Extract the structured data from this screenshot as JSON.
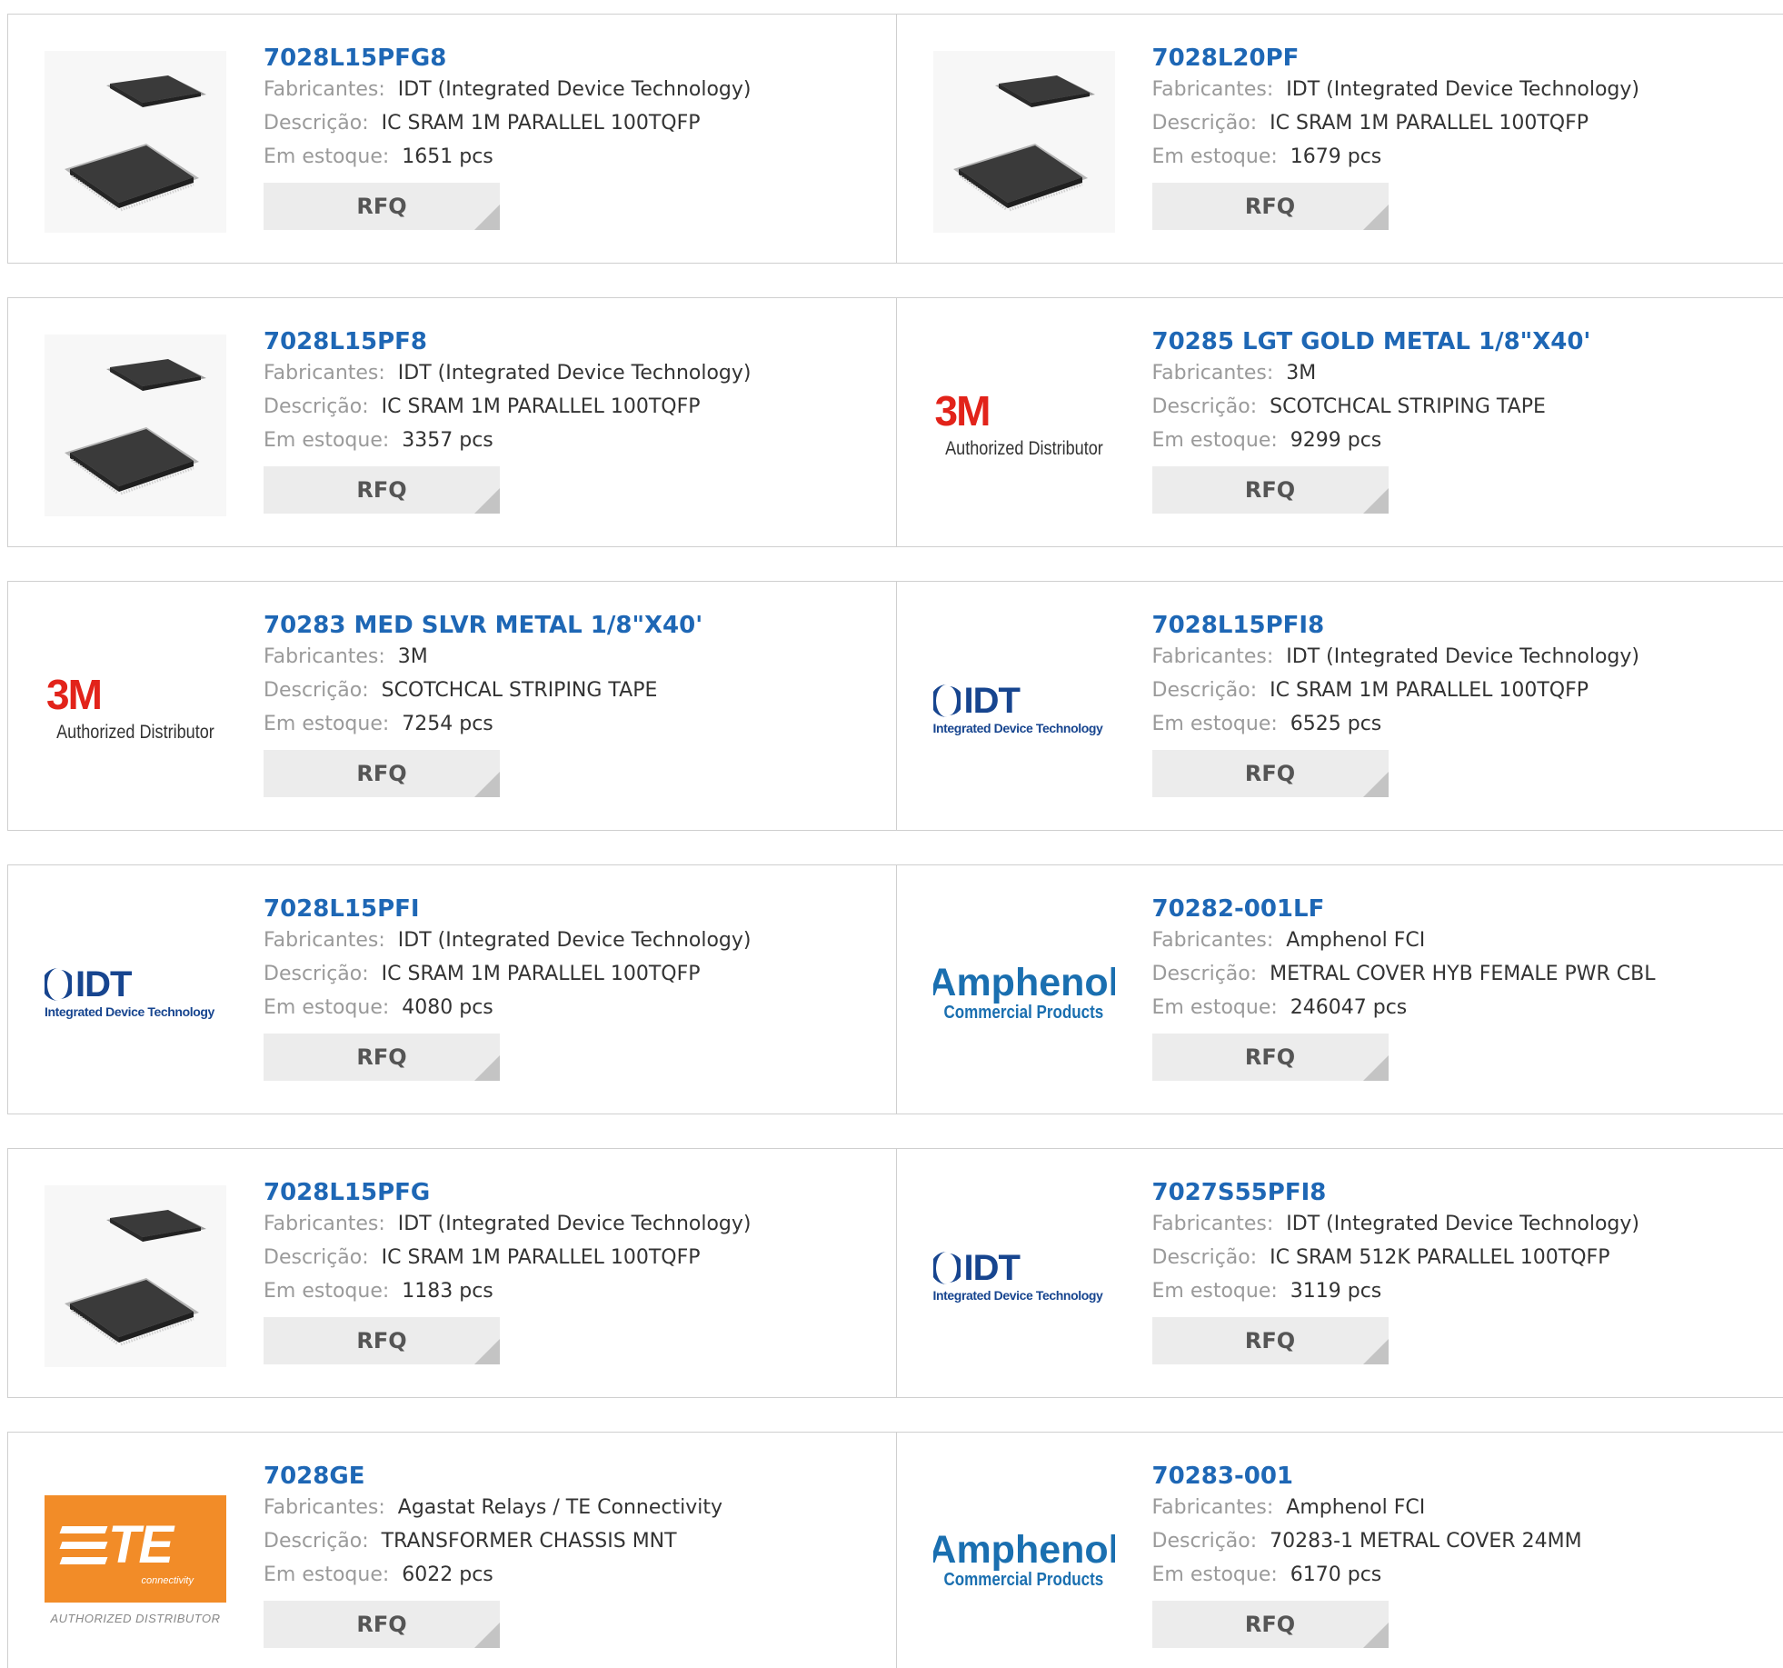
{
  "labels": {
    "manufacturer": "Fabricantes:",
    "description": "Descrição:",
    "stock": "Em estoque:",
    "rfq": "RFQ"
  },
  "logo_text": {
    "m3_mark": "3M",
    "m3_sub": "Authorized Distributor",
    "idt_mark": "IDT",
    "idt_sub": "Integrated Device Technology",
    "amph_mark": "Amphenol",
    "amph_sub": "Commercial Products",
    "te_mark": "TE",
    "te_conn": "connectivity",
    "te_sub": "AUTHORIZED DISTRIBUTOR"
  },
  "colors": {
    "title": "#1e67b5",
    "label": "#9a9a9a",
    "rfq_bg": "#ececec",
    "border": "#cfcfcf"
  },
  "products": [
    {
      "image": "tqfp-chip-image",
      "part": "7028L15PFG8",
      "manufacturer": "IDT (Integrated Device Technology)",
      "description": "IC SRAM 1M PARALLEL 100TQFP",
      "stock": "1651 pcs"
    },
    {
      "image": "tqfp-chip-image",
      "part": "7028L20PF",
      "manufacturer": "IDT (Integrated Device Technology)",
      "description": "IC SRAM 1M PARALLEL 100TQFP",
      "stock": "1679 pcs"
    },
    {
      "image": "tqfp-chip-image",
      "part": "7028L15PF8",
      "manufacturer": "IDT (Integrated Device Technology)",
      "description": "IC SRAM 1M PARALLEL 100TQFP",
      "stock": "3357 pcs"
    },
    {
      "image": "3m-logo",
      "part": "70285 LGT GOLD METAL 1/8\"X40'",
      "manufacturer": "3M",
      "description": "SCOTCHCAL STRIPING TAPE",
      "stock": "9299 pcs"
    },
    {
      "image": "3m-logo",
      "part": "70283 MED SLVR METAL 1/8\"X40'",
      "manufacturer": "3M",
      "description": "SCOTCHCAL STRIPING TAPE",
      "stock": "7254 pcs"
    },
    {
      "image": "idt-logo",
      "part": "7028L15PFI8",
      "manufacturer": "IDT (Integrated Device Technology)",
      "description": "IC SRAM 1M PARALLEL 100TQFP",
      "stock": "6525 pcs"
    },
    {
      "image": "idt-logo",
      "part": "7028L15PFI",
      "manufacturer": "IDT (Integrated Device Technology)",
      "description": "IC SRAM 1M PARALLEL 100TQFP",
      "stock": "4080 pcs"
    },
    {
      "image": "amphenol-logo",
      "part": "70282-001LF",
      "manufacturer": "Amphenol FCI",
      "description": "METRAL COVER HYB FEMALE PWR CBL",
      "stock": "246047 pcs"
    },
    {
      "image": "tqfp-chip-image",
      "part": "7028L15PFG",
      "manufacturer": "IDT (Integrated Device Technology)",
      "description": "IC SRAM 1M PARALLEL 100TQFP",
      "stock": "1183 pcs"
    },
    {
      "image": "idt-logo",
      "part": "7027S55PFI8",
      "manufacturer": "IDT (Integrated Device Technology)",
      "description": "IC SRAM 512K PARALLEL 100TQFP",
      "stock": "3119 pcs"
    },
    {
      "image": "te-connectivity-logo",
      "part": "7028GE",
      "manufacturer": "Agastat Relays / TE Connectivity",
      "description": "TRANSFORMER CHASSIS MNT",
      "stock": "6022 pcs"
    },
    {
      "image": "amphenol-logo",
      "part": "70283-001",
      "manufacturer": "Amphenol FCI",
      "description": "70283-1 METRAL COVER 24MM",
      "stock": "6170 pcs"
    }
  ]
}
